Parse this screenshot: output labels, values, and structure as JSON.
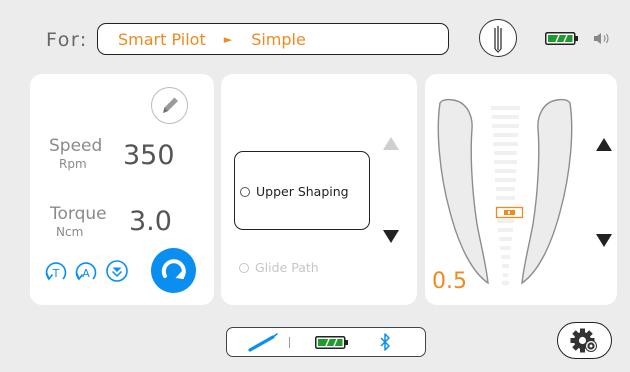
{
  "header": {
    "for_label": "For:",
    "program_name": "Smart Pilot",
    "program_separator": "►",
    "program_mode": "Simple",
    "icons": [
      "file-library-icon",
      "battery-icon",
      "sound-icon"
    ],
    "battery_level": 1.0,
    "battery_color": "#1e9b2d"
  },
  "settings_panel": {
    "speed_label": "Speed",
    "speed_unit": "Rpm",
    "speed_value": "350",
    "torque_label": "Torque",
    "torque_unit": "Ncm",
    "torque_value": "3.0",
    "mode_icons": [
      "torque-mode-icon",
      "auto-reverse-icon",
      "auto-forward-icon"
    ],
    "start_icon": "rotation-start-icon",
    "accent_color": "#0a8ff0"
  },
  "steps_panel": {
    "steps": [
      {
        "label": "Upper Shaping",
        "selected": true
      },
      {
        "label": "Glide Path",
        "selected": false
      }
    ]
  },
  "torque_panel": {
    "torque_readout": "0.5",
    "readout_color": "#f08a1d"
  },
  "status_bar": {
    "icons": [
      "handpiece-icon",
      "battery-icon",
      "bluetooth-icon"
    ],
    "battery_level": 1.0
  },
  "footer": {
    "settings_icon": "settings-gear-icon"
  }
}
